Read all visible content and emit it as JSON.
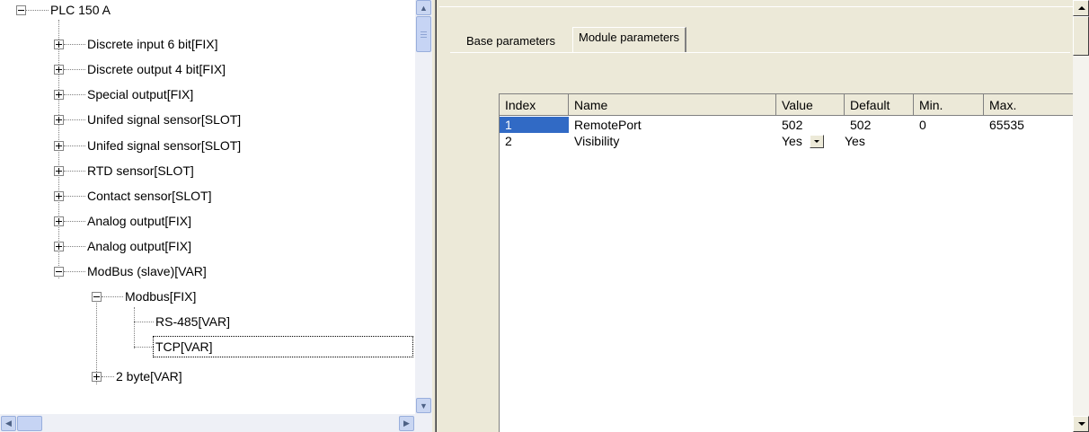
{
  "tree": {
    "root": {
      "label": "PLC 150 A"
    },
    "items": [
      {
        "label": "Discrete input 6 bit[FIX]"
      },
      {
        "label": "Discrete output 4 bit[FIX]"
      },
      {
        "label": "Special output[FIX]"
      },
      {
        "label": "Unifed signal sensor[SLOT]"
      },
      {
        "label": "Unifed signal sensor[SLOT]"
      },
      {
        "label": "RTD sensor[SLOT]"
      },
      {
        "label": "Contact sensor[SLOT]"
      },
      {
        "label": "Analog output[FIX]"
      },
      {
        "label": "Analog output[FIX]"
      },
      {
        "label": "ModBus (slave)[VAR]"
      }
    ],
    "modbus_children": [
      {
        "label": "Modbus[FIX]"
      },
      {
        "label": "2 byte[VAR]"
      }
    ],
    "modbus_fix_children": [
      {
        "label": "RS-485[VAR]"
      },
      {
        "label": "TCP[VAR]",
        "selected": true
      }
    ]
  },
  "tabs": {
    "base": {
      "label": "Base parameters"
    },
    "module": {
      "label": "Module parameters",
      "active": true
    }
  },
  "grid": {
    "columns": [
      "Index",
      "Name",
      "Value",
      "Default",
      "Min.",
      "Max."
    ],
    "rows": [
      {
        "index": "1",
        "name": "RemotePort",
        "value": "502",
        "default": "502",
        "min": "0",
        "max": "65535",
        "selected": true
      },
      {
        "index": "2",
        "name": "Visibility",
        "value": "Yes",
        "default": "Yes",
        "min": "",
        "max": "",
        "dropdown": true
      }
    ]
  },
  "colors": {
    "selection": "#316ac5",
    "dialog_face": "#ece9d8",
    "scrollbar_blue": "#c6d4f4"
  },
  "icons": {
    "tree_expand": "plus-box",
    "tree_collapse": "minus-box",
    "scroll_up": "chevron-up",
    "scroll_down": "chevron-down",
    "scroll_left": "chevron-left",
    "scroll_right": "chevron-right",
    "dropdown": "triangle-down"
  }
}
